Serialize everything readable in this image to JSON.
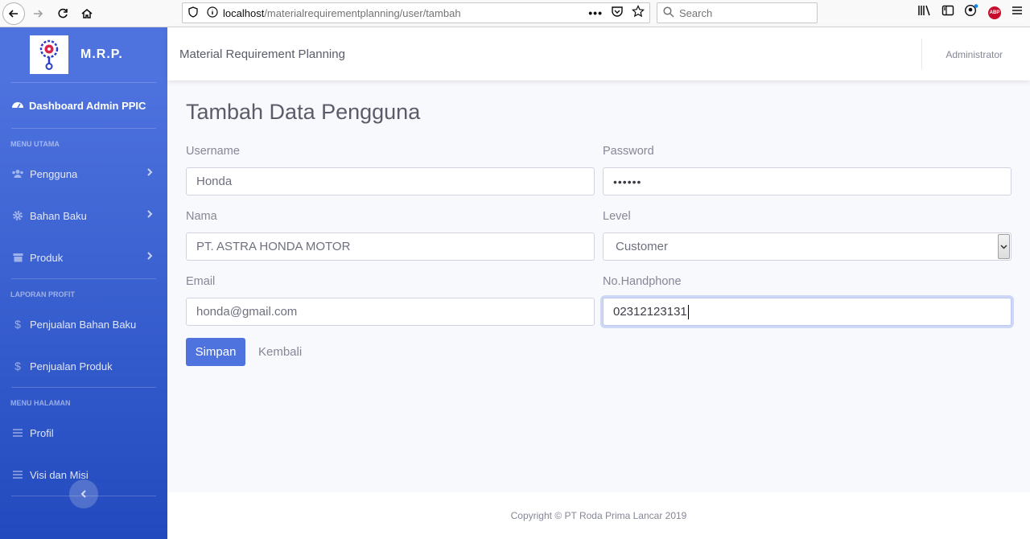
{
  "browser": {
    "url_host": "localhost",
    "url_path": "/materialrequirementplanning/user/tambah",
    "search_placeholder": "Search",
    "abp_label": "ABP"
  },
  "sidebar": {
    "brand": "M.R.P.",
    "dashboard": "Dashboard Admin PPIC",
    "sections": [
      {
        "heading": "MENU UTAMA",
        "items": [
          {
            "label": "Pengguna",
            "icon": "users-icon",
            "has_submenu": true
          },
          {
            "label": "Bahan Baku",
            "icon": "cog-icon",
            "has_submenu": true
          },
          {
            "label": "Produk",
            "icon": "box-icon",
            "has_submenu": true
          }
        ]
      },
      {
        "heading": "LAPORAN PROFIT",
        "items": [
          {
            "label": "Penjualan Bahan Baku",
            "icon": "dollar-icon"
          },
          {
            "label": "Penjualan Produk",
            "icon": "dollar-icon"
          }
        ]
      },
      {
        "heading": "MENU HALAMAN",
        "items": [
          {
            "label": "Profil",
            "icon": "list-icon"
          },
          {
            "label": "Visi dan Misi",
            "icon": "list-icon"
          }
        ]
      }
    ]
  },
  "topbar": {
    "title": "Material Requirement Planning",
    "user": "Administrator"
  },
  "form": {
    "title": "Tambah Data Pengguna",
    "username_label": "Username",
    "username_value": "Honda",
    "password_label": "Password",
    "password_value": "••••••",
    "nama_label": "Nama",
    "nama_value": "PT. ASTRA HONDA MOTOR",
    "level_label": "Level",
    "level_value": "Customer",
    "email_label": "Email",
    "email_value": "honda@gmail.com",
    "phone_label": "No.Handphone",
    "phone_value": "02312123131",
    "save_label": "Simpan",
    "back_label": "Kembali"
  },
  "footer": {
    "copyright": "Copyright © PT Roda Prima Lancar 2019"
  },
  "colors": {
    "primary": "#4e73df",
    "primary_dark": "#224abe",
    "text": "#858796"
  }
}
